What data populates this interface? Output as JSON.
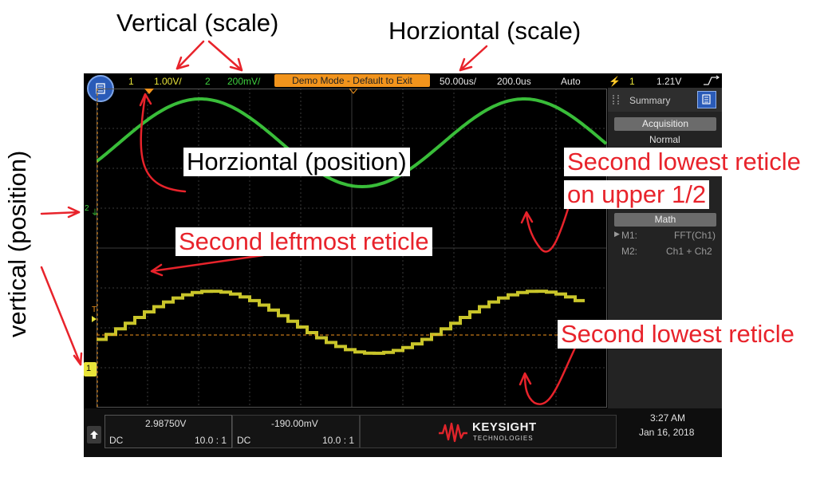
{
  "annotations": {
    "vertical_scale": "Vertical (scale)",
    "horizontal_scale": "Horziontal (scale)",
    "horizontal_position": "Horziontal (position)",
    "vertical_position": "vertical (position)",
    "second_leftmost": "Second leftmost reticle",
    "second_lowest_upper_line1": "Second lowest reticle",
    "second_lowest_upper_line2": "on upper 1/2",
    "second_lowest": "Second lowest reticle"
  },
  "scope": {
    "top_bar": {
      "ch1_num": "1",
      "ch1_scale": "1.00V/",
      "ch2_num": "2",
      "ch2_scale": "200mV/",
      "demo_mode": "Demo Mode - Default to Exit",
      "timebase": "50.00us/",
      "delay": "200.0us",
      "trigger_mode": "Auto",
      "trigger_source": "1",
      "trigger_level": "1.21V"
    },
    "side_panel": {
      "summary": "Summary",
      "acquisition_btn": "Acquisition",
      "acquisition_val": "Normal",
      "math_btn": "Math",
      "m1_label": "M1:",
      "m1_val": "FFT(Ch1)",
      "m2_label": "M2:",
      "m2_val": "Ch1 + Ch2"
    },
    "markers": {
      "ch2_marker": "2",
      "ch1_marker": "1",
      "trigger_marker": "T"
    },
    "bottom_bar": {
      "ch1_value": "2.98750V",
      "ch1_coupling": "DC",
      "ch1_probe": "10.0 : 1",
      "ch2_value": "-190.00mV",
      "ch2_coupling": "DC",
      "ch2_probe": "10.0 : 1",
      "brand": "KEYSIGHT",
      "brand_sub": "TECHNOLOGIES",
      "time": "3:27 AM",
      "date": "Jan 16, 2018"
    },
    "colors": {
      "ch1": "#e8e43a",
      "ch2": "#3fd13f",
      "accent": "#f2941c",
      "annotation": "#e8232b"
    }
  }
}
